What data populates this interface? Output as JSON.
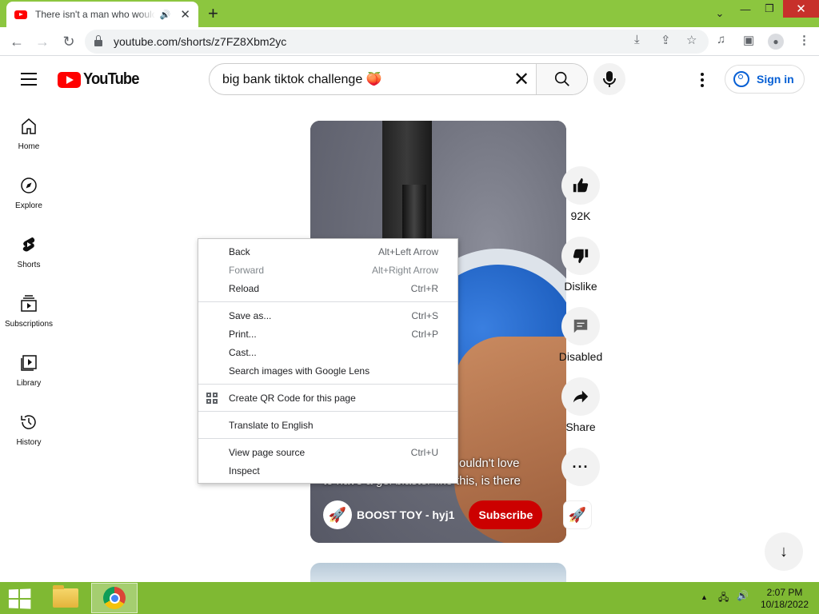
{
  "browser": {
    "tab_title": "There isn't a man who would",
    "url": "youtube.com/shorts/z7FZ8Xbm2yc"
  },
  "youtube": {
    "logo_text": "YouTube",
    "search_query": "big bank tiktok challenge 🍑",
    "signin_label": "Sign in",
    "guide": [
      {
        "label": "Home",
        "icon": "home-icon"
      },
      {
        "label": "Explore",
        "icon": "compass-icon"
      },
      {
        "label": "Shorts",
        "icon": "shorts-icon"
      },
      {
        "label": "Subscriptions",
        "icon": "subscriptions-icon"
      },
      {
        "label": "Library",
        "icon": "library-icon"
      },
      {
        "label": "History",
        "icon": "history-icon"
      }
    ],
    "video": {
      "caption_line1": "ouldn't love",
      "caption_line2": "to have a gel blaster like this, is there",
      "channel_name": "BOOST TOY - hyj1",
      "subscribe_label": "Subscribe"
    },
    "actions": {
      "likes": "92K",
      "dislike": "Dislike",
      "comments": "Disabled",
      "share": "Share"
    }
  },
  "context_menu": {
    "groups": [
      [
        {
          "label": "Back",
          "shortcut": "Alt+Left Arrow",
          "disabled": false
        },
        {
          "label": "Forward",
          "shortcut": "Alt+Right Arrow",
          "disabled": true
        },
        {
          "label": "Reload",
          "shortcut": "Ctrl+R",
          "disabled": false
        }
      ],
      [
        {
          "label": "Save as...",
          "shortcut": "Ctrl+S",
          "disabled": false
        },
        {
          "label": "Print...",
          "shortcut": "Ctrl+P",
          "disabled": false
        },
        {
          "label": "Cast...",
          "shortcut": "",
          "disabled": false
        },
        {
          "label": "Search images with Google Lens",
          "shortcut": "",
          "disabled": false
        }
      ],
      [
        {
          "label": "Create QR Code for this page",
          "shortcut": "",
          "disabled": false,
          "icon": "qr-code-icon"
        }
      ],
      [
        {
          "label": "Translate to English",
          "shortcut": "",
          "disabled": false
        }
      ],
      [
        {
          "label": "View page source",
          "shortcut": "Ctrl+U",
          "disabled": false
        },
        {
          "label": "Inspect",
          "shortcut": "",
          "disabled": false
        }
      ]
    ]
  },
  "taskbar": {
    "time": "2:07 PM",
    "date": "10/18/2022"
  },
  "colors": {
    "accent_green": "#8cc63f",
    "youtube_red": "#ff0000",
    "subscribe_red": "#cc0000",
    "signin_blue": "#065fd4"
  }
}
